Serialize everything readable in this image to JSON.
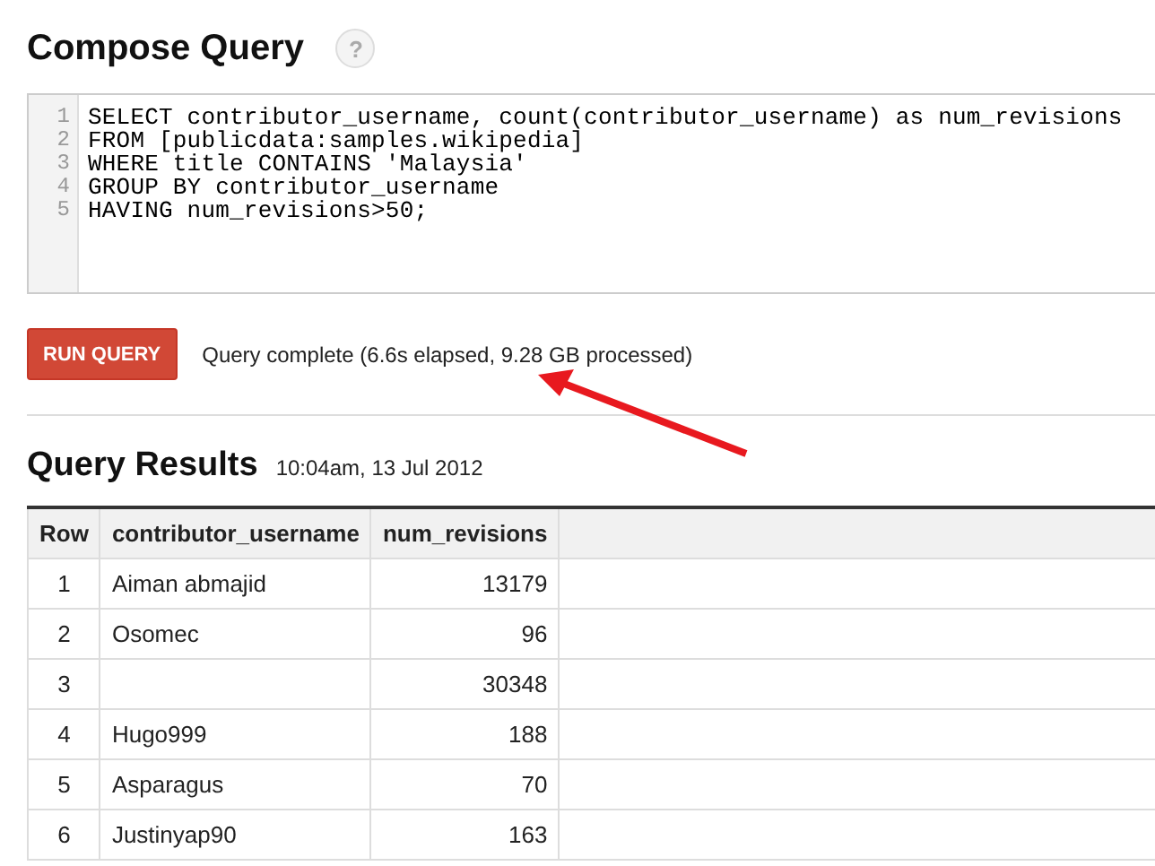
{
  "compose": {
    "title": "Compose Query",
    "help": "?",
    "code_lines": [
      {
        "number": "1",
        "text": "SELECT contributor_username, count(contributor_username) as num_revisions"
      },
      {
        "number": "2",
        "text": "FROM [publicdata:samples.wikipedia]"
      },
      {
        "number": "3",
        "text": "WHERE title CONTAINS 'Malaysia'"
      },
      {
        "number": "4",
        "text": "GROUP BY contributor_username"
      },
      {
        "number": "5",
        "text": "HAVING num_revisions>50;"
      }
    ],
    "run_button": "RUN QUERY",
    "status": "Query complete (6.6s elapsed, 9.28 GB processed)"
  },
  "results": {
    "title": "Query Results",
    "timestamp": "10:04am, 13 Jul 2012",
    "columns": [
      "Row",
      "contributor_username",
      "num_revisions"
    ],
    "rows": [
      {
        "row": "1",
        "username": "Aiman abmajid",
        "num_revisions": "13179"
      },
      {
        "row": "2",
        "username": "Osomec",
        "num_revisions": "96"
      },
      {
        "row": "3",
        "num_revisions": "30348"
      },
      {
        "row": "4",
        "username": "Hugo999",
        "num_revisions": "188"
      },
      {
        "row": "5",
        "username": "Asparagus",
        "num_revisions": "70"
      },
      {
        "row": "6",
        "username": "Justinyap90",
        "num_revisions": "163"
      }
    ]
  }
}
